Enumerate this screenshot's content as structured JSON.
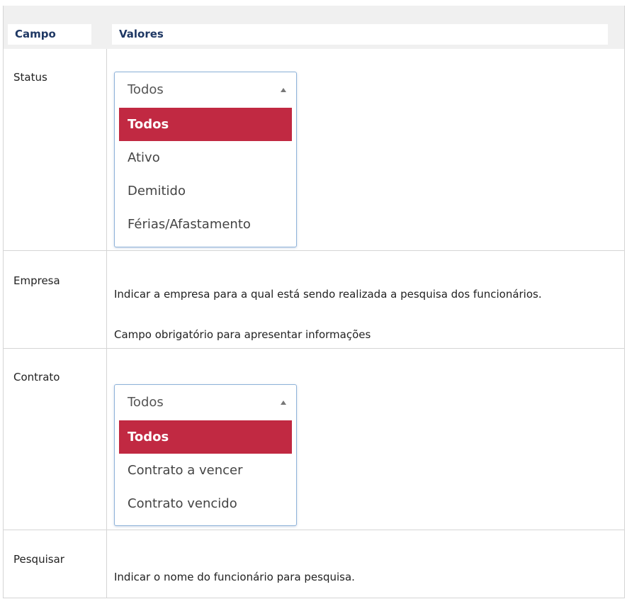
{
  "header": {
    "campo": "Campo",
    "valores": "Valores"
  },
  "rows": {
    "status": {
      "label": "Status",
      "dropdown": {
        "value": "Todos",
        "options": [
          "Todos",
          "Ativo",
          "Demitido",
          "Férias/Afastamento"
        ]
      }
    },
    "empresa": {
      "label": "Empresa",
      "line1": "Indicar a empresa para a qual está sendo realizada a pesquisa dos funcionários.",
      "line2": "Campo obrigatório para apresentar informações"
    },
    "contrato": {
      "label": "Contrato",
      "dropdown": {
        "value": "Todos",
        "options": [
          "Todos",
          "Contrato a vencer",
          "Contrato vencido"
        ]
      }
    },
    "pesquisar": {
      "label": "Pesquisar",
      "line1": "Indicar o nome do funcionário para pesquisa."
    }
  },
  "colors": {
    "selected": "#c12942",
    "header_text": "#1f3864",
    "border": "#d5d5d5"
  },
  "icons": {
    "dropdown_arrow": "caret-up-icon"
  }
}
